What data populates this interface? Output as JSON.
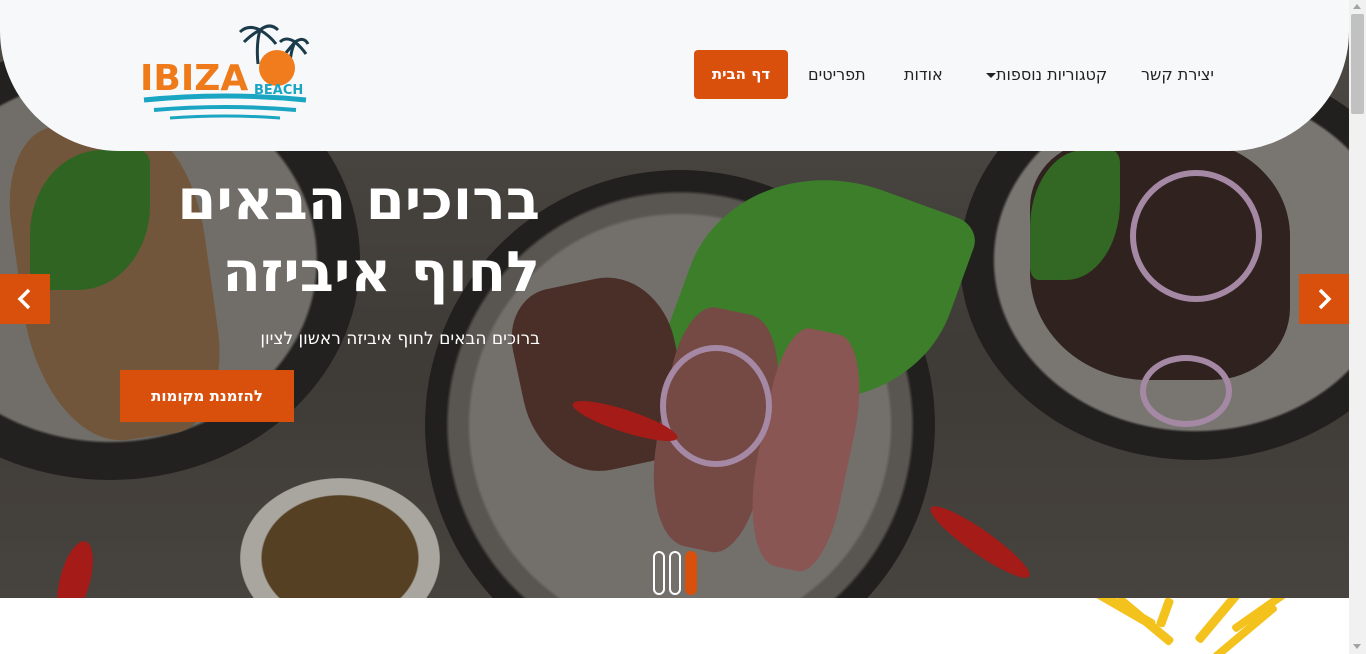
{
  "header": {
    "logo": {
      "text_main": "IBIZA",
      "text_sub": "BEACH",
      "icon": "palm-tree-logo"
    },
    "nav": [
      {
        "label": "דף הבית",
        "active": true
      },
      {
        "label": "תפריטים"
      },
      {
        "label": "אודות"
      },
      {
        "label": "קטגוריות נוספות",
        "has_dropdown": true
      },
      {
        "label": "יצירת קשר"
      }
    ]
  },
  "hero": {
    "title_line1": "ברוכים הבאים",
    "title_line2": "לחוף איביזה",
    "subtitle": "ברוכים הבאים לחוף איביזה ראשון לציון",
    "cta_label": "להזמנת מקומות",
    "prev_icon": "chevron-left-icon",
    "next_icon": "chevron-right-icon",
    "slides_count": 3,
    "active_slide": 3
  },
  "colors": {
    "accent": "#d94f0c",
    "header_bg": "#f7f8fa"
  }
}
